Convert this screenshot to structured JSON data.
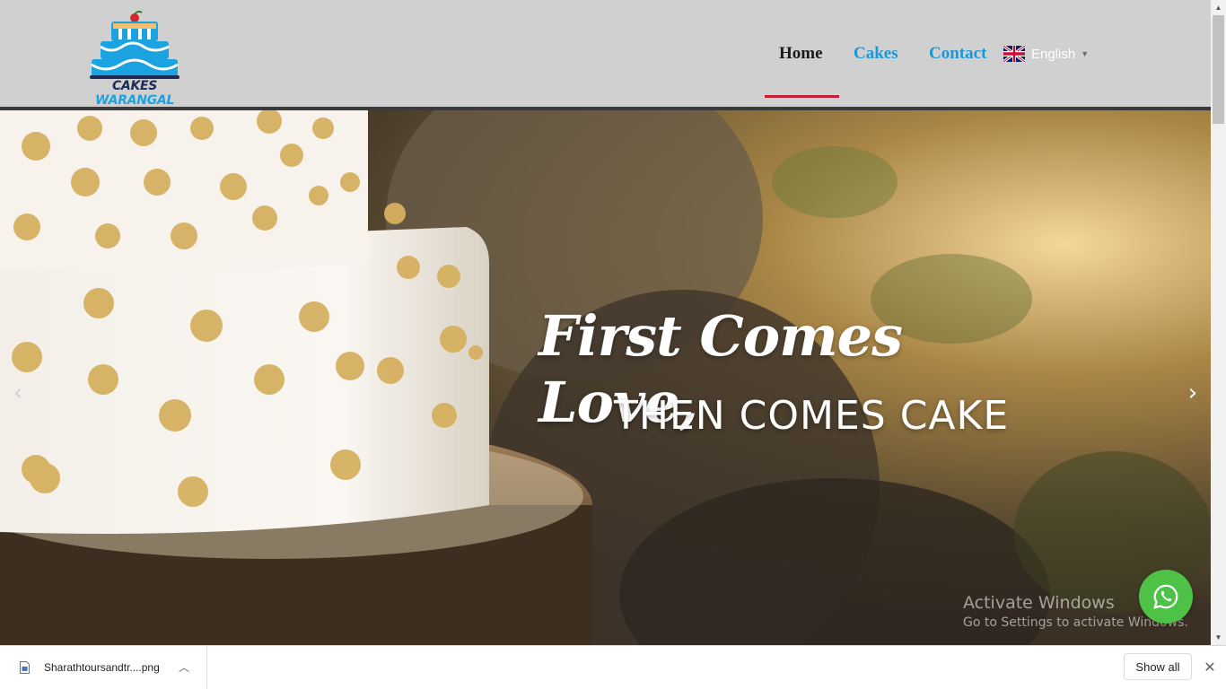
{
  "header": {
    "logo_word1": "CAKES",
    "logo_word2": "WARANGAL"
  },
  "nav": {
    "items": [
      {
        "label": "Home",
        "active": true
      },
      {
        "label": "Cakes"
      },
      {
        "label": "Contact"
      }
    ],
    "language": "English",
    "language_flag_icon": "uk-flag-icon"
  },
  "hero": {
    "line1": "First Comes Love,",
    "line2": "THEN COMES CAKE",
    "prev_icon": "chevron-left-icon",
    "next_icon": "chevron-right-icon"
  },
  "watermark": {
    "title": "Activate Windows",
    "subtitle": "Go to Settings to activate Windows."
  },
  "whatsapp_icon": "whatsapp-icon",
  "download_bar": {
    "file_name": "Sharathtoursandtr....png",
    "show_all_label": "Show all"
  },
  "colors": {
    "header_bg": "#d0d0d0",
    "nav_link": "#1a98d5",
    "active_underline": "#c22035",
    "whatsapp_green": "#4dc247"
  }
}
